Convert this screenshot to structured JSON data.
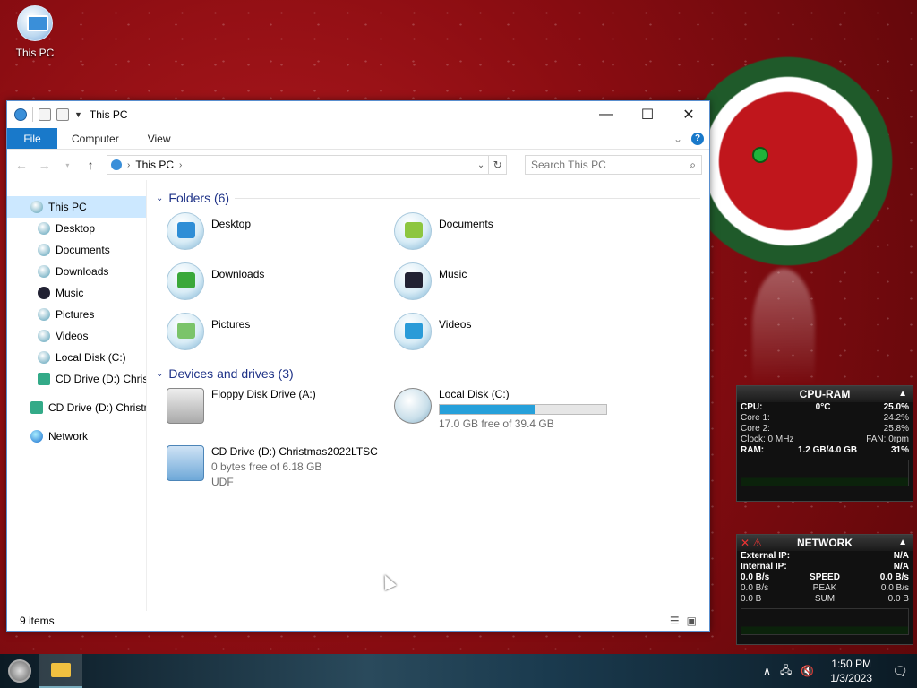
{
  "desktop": {
    "icon_label": "This PC"
  },
  "window": {
    "title": "This PC",
    "controls": {
      "minimize": "—",
      "maximize": "☐",
      "close": "✕"
    },
    "ribbon": {
      "file": "File",
      "computer": "Computer",
      "view": "View",
      "help": "?"
    },
    "address": {
      "location": "This PC"
    },
    "search": {
      "placeholder": "Search This PC"
    },
    "nav": [
      {
        "label": "This PC",
        "selected": true
      },
      {
        "label": "Desktop"
      },
      {
        "label": "Documents"
      },
      {
        "label": "Downloads"
      },
      {
        "label": "Music"
      },
      {
        "label": "Pictures"
      },
      {
        "label": "Videos"
      },
      {
        "label": "Local Disk (C:)"
      },
      {
        "label": "CD Drive (D:) Christ"
      },
      {
        "label": "CD Drive (D:) Christm"
      },
      {
        "label": "Network"
      }
    ],
    "folders": {
      "header": "Folders (6)",
      "items": [
        "Desktop",
        "Documents",
        "Downloads",
        "Music",
        "Pictures",
        "Videos"
      ]
    },
    "devices": {
      "header": "Devices and drives (3)",
      "floppy": {
        "name": "Floppy Disk Drive (A:)"
      },
      "local": {
        "name": "Local Disk (C:)",
        "free": "17.0 GB free of 39.4 GB",
        "used_fraction": 0.57
      },
      "cd": {
        "name": "CD Drive (D:) Christmas2022LTSC",
        "free": "0 bytes free of 6.18 GB",
        "fs": "UDF"
      }
    },
    "status": {
      "items": "9 items"
    }
  },
  "cpu_gadget": {
    "title": "CPU-RAM",
    "cpu_label": "CPU:",
    "temp": "0°C",
    "cpu_val": "25.0%",
    "core1_label": "Core 1:",
    "core1_val": "24.2%",
    "core2_label": "Core 2:",
    "core2_val": "25.8%",
    "clock": "Clock: 0 MHz",
    "fan": "FAN: 0rpm",
    "ram_label": "RAM:",
    "ram_val": "1.2 GB/4.0 GB",
    "ram_pct": "31%"
  },
  "net_gadget": {
    "title": "NETWORK",
    "ext_label": "External IP:",
    "ext_val": "N/A",
    "int_label": "Internal IP:",
    "int_val": "N/A",
    "speed_l": "0.0 B/s",
    "speed_m": "SPEED",
    "speed_r": "0.0 B/s",
    "peak_l": "0.0 B/s",
    "peak_m": "PEAK",
    "peak_r": "0.0 B/s",
    "sum_l": "0.0 B",
    "sum_m": "SUM",
    "sum_r": "0.0 B"
  },
  "taskbar": {
    "time": "1:50 PM",
    "date": "1/3/2023"
  }
}
